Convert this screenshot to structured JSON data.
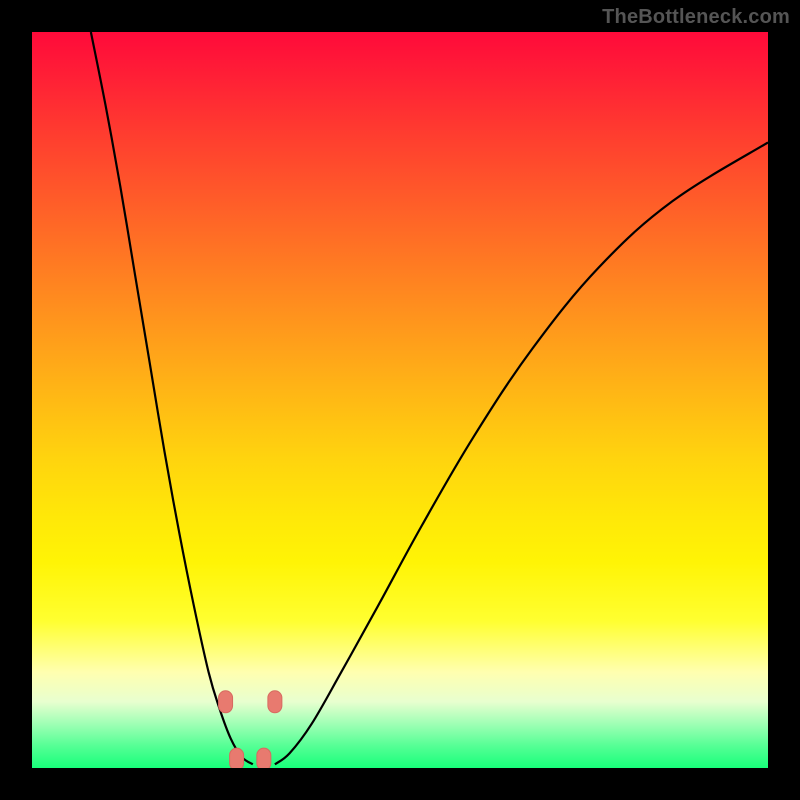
{
  "watermark": "TheBottleneck.com",
  "colors": {
    "background": "#000000",
    "curve": "#000000",
    "marker_fill": "#e87a6f",
    "marker_stroke": "#d86a60"
  },
  "chart_data": {
    "type": "line",
    "title": "",
    "xlabel": "",
    "ylabel": "",
    "xlim": [
      0,
      100
    ],
    "ylim": [
      0,
      100
    ],
    "grid": false,
    "series": [
      {
        "name": "left-branch",
        "x": [
          8,
          10,
          12,
          14,
          16,
          18,
          20,
          22,
          24,
          25.5,
          27,
          28.5,
          30
        ],
        "y": [
          100,
          90,
          79,
          67,
          55,
          43,
          32,
          22,
          13,
          8,
          4,
          1.5,
          0.5
        ]
      },
      {
        "name": "right-branch",
        "x": [
          33,
          35,
          38,
          42,
          47,
          53,
          60,
          68,
          77,
          87,
          100
        ],
        "y": [
          0.5,
          2,
          6,
          13,
          22,
          33,
          45,
          57,
          68,
          77,
          85
        ]
      }
    ],
    "markers": [
      {
        "x": 26.3,
        "y": 9.0
      },
      {
        "x": 33.0,
        "y": 9.0
      },
      {
        "x": 27.8,
        "y": 1.2
      },
      {
        "x": 31.5,
        "y": 1.2
      }
    ],
    "description": "V-shaped bottleneck curve on a red-to-green vertical gradient; minimum near x≈30 along the green band at the bottom."
  }
}
